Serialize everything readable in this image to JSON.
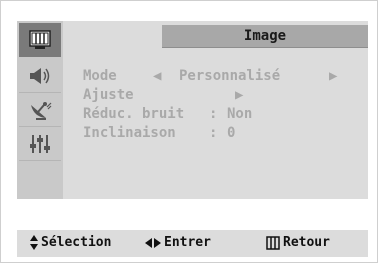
{
  "menu": {
    "title": "Image",
    "rows": [
      {
        "label": "Mode",
        "left_arrow": "◀",
        "value": "Personnalisé",
        "right_arrow": "▶"
      },
      {
        "label": "Ajuste",
        "right_arrow": "▶"
      },
      {
        "label": "Réduc. bruit",
        "sep": ":",
        "value": "Non"
      },
      {
        "label": "Inclinaison",
        "sep": ":",
        "value": "0"
      }
    ]
  },
  "sidebar": {
    "items": [
      {
        "icon": "picture-icon",
        "active": true
      },
      {
        "icon": "speaker-icon",
        "active": false
      },
      {
        "icon": "satellite-dish-icon",
        "active": false
      },
      {
        "icon": "settings-sliders-icon",
        "active": false
      },
      {
        "icon": "empty",
        "active": false
      }
    ]
  },
  "status": {
    "select_label": "Sélection",
    "enter_label": "Entrer",
    "return_label": "Retour",
    "select_icon": "up-down-arrows-icon",
    "enter_icon": "left-right-arrows-icon",
    "return_icon": "menu-icon"
  },
  "colors": {
    "panel": "#dcdcdc",
    "sidebar": "#c9c9c9",
    "active_tab": "#7a7a7a",
    "title_bar": "#a8a8a8",
    "menu_text": "#a9a9a9",
    "status_text": "#111111"
  }
}
